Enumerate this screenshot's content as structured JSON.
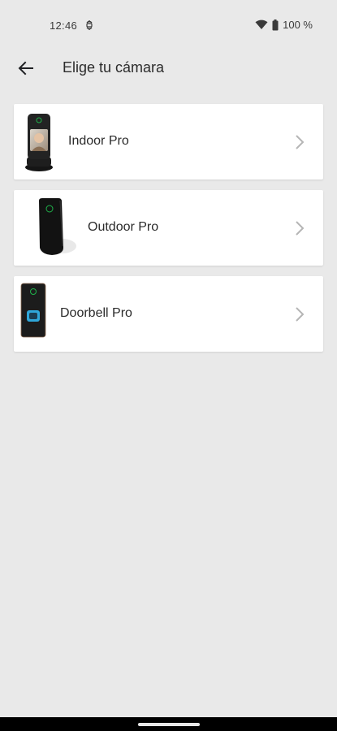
{
  "status_bar": {
    "time": "12:46",
    "battery_text": "100 %",
    "icons": [
      "sync-icon",
      "wifi-icon",
      "battery-icon"
    ]
  },
  "app_bar": {
    "back_icon": "arrow-left-icon",
    "title": "Elige tu cámara"
  },
  "cameras": [
    {
      "label": "Indoor Pro",
      "image": "indoor-pro-device-image"
    },
    {
      "label": "Outdoor Pro",
      "image": "outdoor-pro-device-image"
    },
    {
      "label": "Doorbell Pro",
      "image": "doorbell-pro-device-image"
    }
  ],
  "colors": {
    "background": "#e9e9e9",
    "card": "#ffffff",
    "chevron": "#b5b5b5",
    "device_ring": "#1fb24a",
    "doorbell_button": "#2fa6d9"
  }
}
